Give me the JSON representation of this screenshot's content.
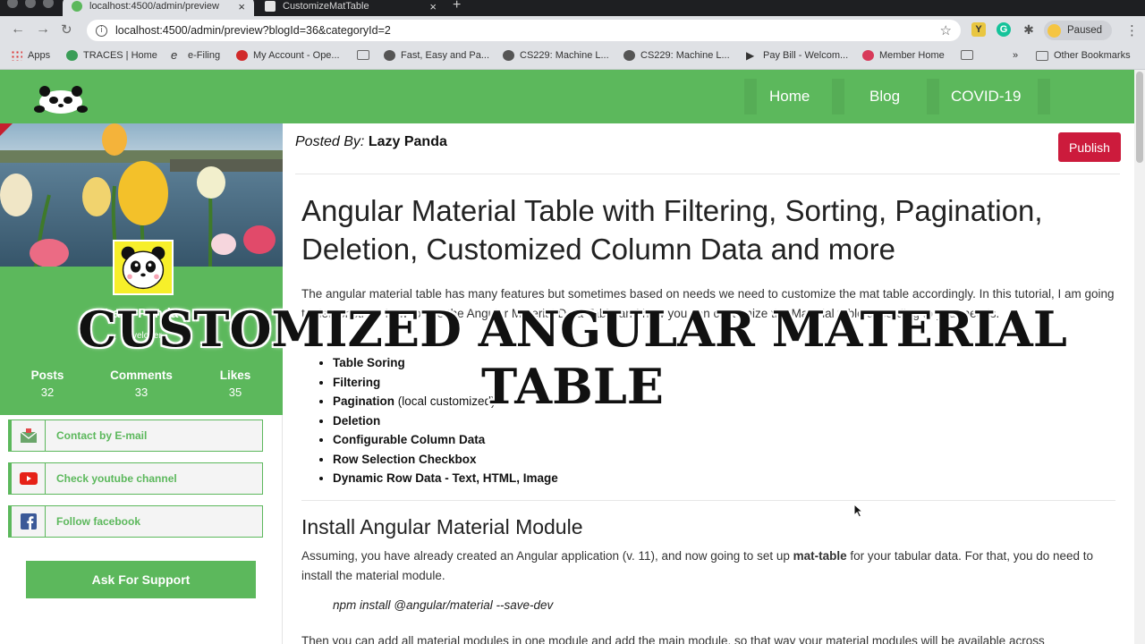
{
  "browser": {
    "tabs": [
      {
        "title": "localhost:4500/admin/preview",
        "active": true
      },
      {
        "title": "CustomizeMatTable",
        "active": false
      }
    ],
    "url": "localhost:4500/admin/preview?blogId=36&categoryId=2",
    "profile_status": "Paused",
    "bookmarks": [
      "Apps",
      "TRACES | Home",
      "e-Filing",
      "My Account - Ope...",
      "Fast, Easy and Pa...",
      "CS229: Machine L...",
      "CS229: Machine L...",
      "Pay Bill - Welcom...",
      "Member Home",
      "Other Bookmarks"
    ]
  },
  "site_nav": {
    "items": [
      "Home",
      "Blog",
      "COVID-19"
    ]
  },
  "profile": {
    "name": "Lazy Panda",
    "role": "Developer",
    "stats": [
      {
        "label": "Posts",
        "value": "32"
      },
      {
        "label": "Comments",
        "value": "33"
      },
      {
        "label": "Likes",
        "value": "35"
      }
    ],
    "contacts": [
      {
        "label": "Contact by E-mail"
      },
      {
        "label": "Check youtube channel"
      },
      {
        "label": "Follow facebook"
      }
    ],
    "support_label": "Ask For Support"
  },
  "article": {
    "posted_by_label": "Posted By:",
    "author": "Lazy Panda",
    "publish_label": "Publish",
    "title": "Angular Material Table with Filtering, Sorting, Pagination, Deletion, Customized Column Data and more",
    "intro": "The angular material table has many features but sometimes based on needs we need to customize the mat table accordingly. In this tutorial, I am going to demonstrate how to use the Angular Material Data Table and how you can customize the Material table according to your needs.",
    "features": [
      {
        "bold": "Table Soring",
        "rest": ""
      },
      {
        "bold": "Filtering",
        "rest": ""
      },
      {
        "bold": "Pagination",
        "rest": " (local customized)"
      },
      {
        "bold": "Deletion",
        "rest": ""
      },
      {
        "bold": "Configurable Column Data",
        "rest": ""
      },
      {
        "bold": "Row Selection Checkbox",
        "rest": ""
      },
      {
        "bold": "Dynamic Row Data - Text, HTML, Image",
        "rest": ""
      }
    ],
    "section_title": "Install Angular Material Module",
    "para_before": "Assuming, you have already created an Angular application (v. 11), and now going to set up ",
    "para_bold": "mat-table",
    "para_after": " for your tabular data. For that, you do need to install the material module.",
    "code": "npm install @angular/material --save-dev",
    "para2": "Then you can add all material modules in one module and add the main module, so that way your material modules will be available across"
  },
  "overlay_caption": "CUSTOMIZED ANGULAR MATERIAL TABLE",
  "colors": {
    "brand_green": "#5cb85c",
    "publish_red": "#cc1b3c"
  }
}
